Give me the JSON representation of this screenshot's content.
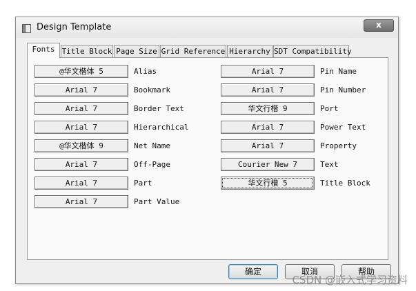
{
  "window": {
    "title": "Design Template",
    "close_label": "x"
  },
  "tabs": [
    {
      "label": "Fonts",
      "active": true
    },
    {
      "label": "Title Block"
    },
    {
      "label": "Page Size"
    },
    {
      "label": "Grid Reference"
    },
    {
      "label": "Hierarchy"
    },
    {
      "label": "SDT Compatibility"
    }
  ],
  "fonts_left": [
    {
      "font": "@华文楷体 5",
      "label": "Alias"
    },
    {
      "font": "Arial 7",
      "label": "Bookmark"
    },
    {
      "font": "Arial 7",
      "label": "Border Text"
    },
    {
      "font": "Arial 7",
      "label": "Hierarchical"
    },
    {
      "font": "@华文楷体 9",
      "label": "Net Name"
    },
    {
      "font": "Arial 7",
      "label": "Off-Page"
    },
    {
      "font": "Arial 7",
      "label": "Part"
    },
    {
      "font": "Arial 7",
      "label": "Part Value"
    }
  ],
  "fonts_right": [
    {
      "font": "Arial 7",
      "label": "Pin Name"
    },
    {
      "font": "Arial 7",
      "label": "Pin Number"
    },
    {
      "font": "华文行楷 9",
      "label": "Port"
    },
    {
      "font": "Arial 7",
      "label": "Power Text"
    },
    {
      "font": "Arial 7",
      "label": "Property"
    },
    {
      "font": "Courier New 7",
      "label": "Text"
    },
    {
      "font": "华文行楷 5",
      "label": "Title Block"
    }
  ],
  "buttons": {
    "ok": "确定",
    "cancel": "取消",
    "help": "帮助"
  },
  "watermark": "CSDN @嵌入式学习资料"
}
